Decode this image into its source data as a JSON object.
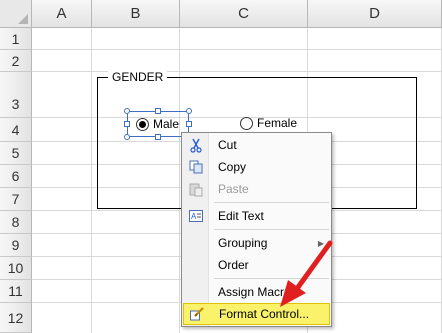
{
  "columns": [
    "A",
    "B",
    "C",
    "D"
  ],
  "rows": [
    "1",
    "2",
    "3",
    "4",
    "5",
    "6",
    "7",
    "8",
    "9",
    "10",
    "11",
    "12"
  ],
  "group_box": {
    "label": "GENDER"
  },
  "options": [
    {
      "label": "Male",
      "selected": true
    },
    {
      "label": "Female",
      "selected": false
    }
  ],
  "context_menu": {
    "items": [
      {
        "label": "Cut",
        "icon": "scissors-icon",
        "enabled": true
      },
      {
        "label": "Copy",
        "icon": "copy-icon",
        "enabled": true
      },
      {
        "label": "Paste",
        "icon": "paste-icon",
        "enabled": false
      },
      {
        "label": "Edit Text",
        "icon": "edit-text-icon",
        "enabled": true
      },
      {
        "label": "Grouping",
        "icon": "",
        "enabled": true,
        "submenu": true
      },
      {
        "label": "Order",
        "icon": "",
        "enabled": true
      },
      {
        "label": "Assign Macro...",
        "icon": "",
        "enabled": true
      },
      {
        "label": "Format Control...",
        "icon": "format-control-icon",
        "enabled": true,
        "highlighted": true
      }
    ]
  },
  "colors": {
    "annotation_arrow": "#e02020",
    "highlight": "#f9f26a",
    "selection": "#3f6fc4"
  }
}
